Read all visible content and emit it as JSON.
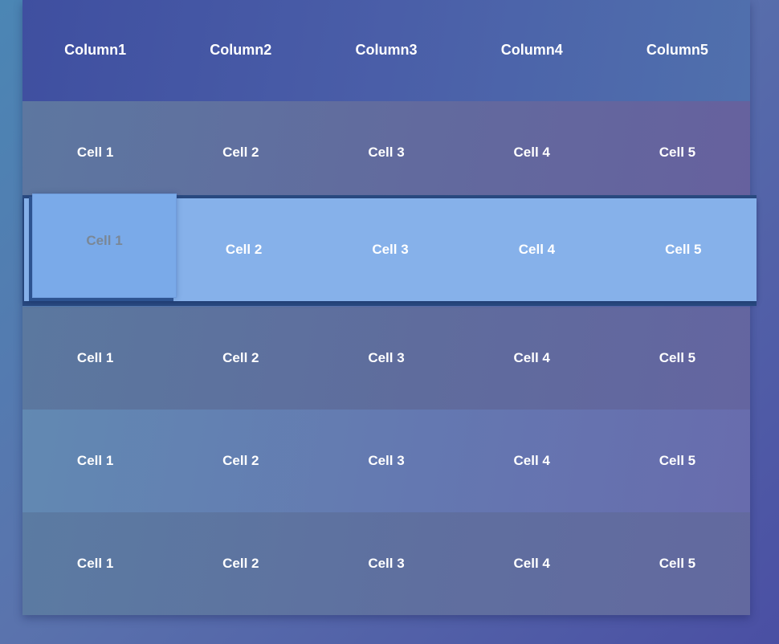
{
  "table": {
    "headers": [
      "Column1",
      "Column2",
      "Column3",
      "Column4",
      "Column5"
    ],
    "rows": [
      [
        "Cell 1",
        "Cell 2",
        "Cell 3",
        "Cell 4",
        "Cell 5"
      ],
      [
        "Cell 1",
        "Cell 2",
        "Cell 3",
        "Cell 4",
        "Cell 5"
      ],
      [
        "Cell 1",
        "Cell 2",
        "Cell 3",
        "Cell 4",
        "Cell 5"
      ],
      [
        "Cell 1",
        "Cell 2",
        "Cell 3",
        "Cell 4",
        "Cell 5"
      ],
      [
        "Cell 1",
        "Cell 2",
        "Cell 3",
        "Cell 4",
        "Cell 5"
      ]
    ]
  },
  "colors": {
    "background": "#4f6fae",
    "header": "#4454a2",
    "highlighted_row": "#86b1ea",
    "popped_cell": "#7aaae9",
    "text": "#ffffff"
  }
}
